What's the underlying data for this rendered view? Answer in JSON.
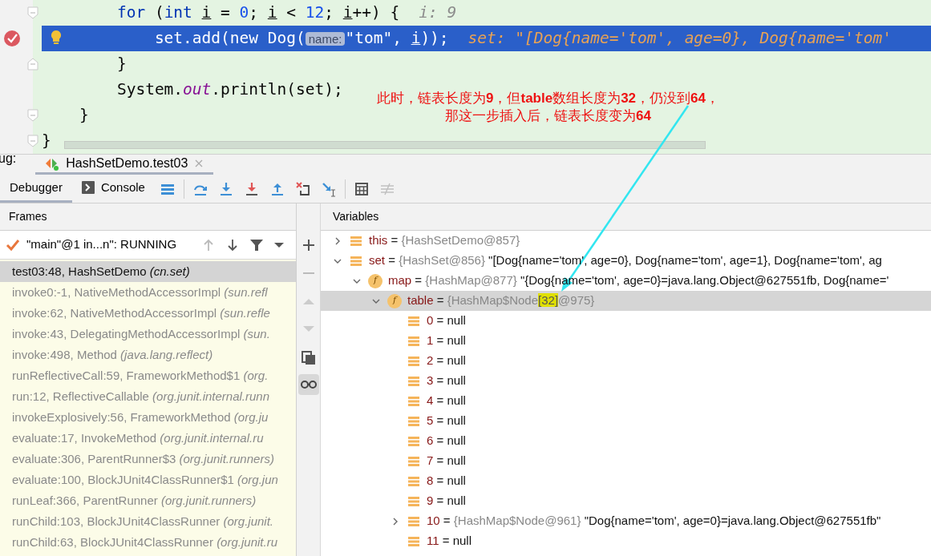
{
  "editor": {
    "lines": [
      {
        "fold": true,
        "breakpoint": false,
        "bulb": false,
        "selected": false,
        "segments": [
          {
            "kind": "keyword",
            "text": "        for"
          },
          {
            "kind": "plain",
            "text": " ("
          },
          {
            "kind": "keyword",
            "text": "int "
          },
          {
            "kind": "var",
            "text": "i"
          },
          {
            "kind": "plain",
            "text": " = "
          },
          {
            "kind": "number",
            "text": "0"
          },
          {
            "kind": "plain",
            "text": "; "
          },
          {
            "kind": "var",
            "text": "i"
          },
          {
            "kind": "plain",
            "text": " < "
          },
          {
            "kind": "number",
            "text": "12"
          },
          {
            "kind": "plain",
            "text": "; "
          },
          {
            "kind": "var",
            "text": "i"
          },
          {
            "kind": "plain",
            "text": "++) {"
          }
        ],
        "inline_value": "i: 9"
      },
      {
        "fold": false,
        "breakpoint": true,
        "bulb": true,
        "selected": true,
        "segments": [
          {
            "kind": "plain",
            "text": "            set.add(new Dog("
          },
          {
            "kind": "hint",
            "text": "name:"
          },
          {
            "kind": "plain",
            "text": "\"tom\", "
          },
          {
            "kind": "var",
            "text": "i"
          },
          {
            "kind": "plain",
            "text": "));"
          }
        ],
        "inline_value": "set: \"[Dog{name='tom', age=0}, Dog{name='tom'"
      },
      {
        "fold": true,
        "breakpoint": false,
        "bulb": false,
        "selected": false,
        "segments": [
          {
            "kind": "plain",
            "text": "        }"
          }
        ]
      },
      {
        "fold": false,
        "breakpoint": false,
        "bulb": false,
        "selected": false,
        "segments": [
          {
            "kind": "plain",
            "text": "        System."
          },
          {
            "kind": "field",
            "text": "out"
          },
          {
            "kind": "plain",
            "text": ".println(set);"
          }
        ]
      },
      {
        "fold": true,
        "breakpoint": false,
        "bulb": false,
        "selected": false,
        "segments": [
          {
            "kind": "plain",
            "text": "    }"
          }
        ]
      },
      {
        "fold": true,
        "breakpoint": false,
        "bulb": false,
        "selected": false,
        "segments": [
          {
            "kind": "plain",
            "text": "}"
          }
        ]
      }
    ]
  },
  "annotation": {
    "lines": [
      "此时，链表长度为**9**，但**table**数组长度为**32**，仍没到**64**，",
      "那这一步插入后，链表长度变为**64**"
    ]
  },
  "debug_bar": {
    "label": "ug:",
    "tabs": [
      {
        "title": "HashSetDemo.test03",
        "selected": true
      }
    ]
  },
  "toolbar": {
    "tabs": [
      {
        "label": "Debugger",
        "selected": true,
        "kind": "debugger"
      },
      {
        "label": "Console",
        "selected": false,
        "kind": "console"
      }
    ]
  },
  "frames": {
    "title": "Frames",
    "thread": "\"main\"@1 in...n\": RUNNING",
    "items": [
      {
        "text": "test03:48, HashSetDemo",
        "package": "(cn.set)",
        "selected": true
      },
      {
        "text": "invoke0:-1, NativeMethodAccessorImpl",
        "package": "(sun.refl",
        "selected": false
      },
      {
        "text": "invoke:62, NativeMethodAccessorImpl",
        "package": "(sun.refle",
        "selected": false
      },
      {
        "text": "invoke:43, DelegatingMethodAccessorImpl",
        "package": "(sun.",
        "selected": false
      },
      {
        "text": "invoke:498, Method",
        "package": "(java.lang.reflect)",
        "selected": false
      },
      {
        "text": "runReflectiveCall:59, FrameworkMethod$1",
        "package": "(org.",
        "selected": false
      },
      {
        "text": "run:12, ReflectiveCallable",
        "package": "(org.junit.internal.runn",
        "selected": false
      },
      {
        "text": "invokeExplosively:56, FrameworkMethod",
        "package": "(org.ju",
        "selected": false
      },
      {
        "text": "evaluate:17, InvokeMethod",
        "package": "(org.junit.internal.ru",
        "selected": false
      },
      {
        "text": "evaluate:306, ParentRunner$3",
        "package": "(org.junit.runners)",
        "selected": false
      },
      {
        "text": "evaluate:100, BlockJUnit4ClassRunner$1",
        "package": "(org.jun",
        "selected": false
      },
      {
        "text": "runLeaf:366, ParentRunner",
        "package": "(org.junit.runners)",
        "selected": false
      },
      {
        "text": "runChild:103, BlockJUnit4ClassRunner",
        "package": "(org.junit.",
        "selected": false
      },
      {
        "text": "runChild:63, BlockJUnit4ClassRunner",
        "package": "(org.junit.ru",
        "selected": false
      }
    ]
  },
  "variables": {
    "title": "Variables",
    "tree": [
      {
        "name": "this",
        "eq": "=",
        "kind": "variable",
        "type": "{HashSetDemo@857}",
        "expanded": false,
        "selected": false
      },
      {
        "name": "set",
        "eq": "=",
        "kind": "variable",
        "type": "{HashSet@856}",
        "value": "\"[Dog{name='tom', age=0}, Dog{name='tom', age=1}, Dog{name='tom', ag",
        "expanded": true,
        "selected": false,
        "children": [
          {
            "name": "map",
            "eq": "=",
            "kind": "field",
            "badge": "f",
            "type": "{HashMap@877}",
            "value": "\"{Dog{name='tom', age=0}=java.lang.Object@627551fb, Dog{name='",
            "expanded": true,
            "selected": false,
            "children": [
              {
                "name": "table",
                "eq": "=",
                "kind": "field",
                "badge": "f",
                "type_parts": [
                  {
                    "text": "{HashMap$Node",
                    "highlighted": false
                  },
                  {
                    "text": "[32]",
                    "highlighted": true
                  },
                  {
                    "text": "@975}",
                    "highlighted": false
                  }
                ],
                "expanded": true,
                "selected": true,
                "children": [
                  {
                    "name": "0",
                    "eq": "=",
                    "kind": "variable",
                    "value": "null",
                    "selected": false
                  },
                  {
                    "name": "1",
                    "eq": "=",
                    "kind": "variable",
                    "value": "null",
                    "selected": false
                  },
                  {
                    "name": "2",
                    "eq": "=",
                    "kind": "variable",
                    "value": "null",
                    "selected": false
                  },
                  {
                    "name": "3",
                    "eq": "=",
                    "kind": "variable",
                    "value": "null",
                    "selected": false
                  },
                  {
                    "name": "4",
                    "eq": "=",
                    "kind": "variable",
                    "value": "null",
                    "selected": false
                  },
                  {
                    "name": "5",
                    "eq": "=",
                    "kind": "variable",
                    "value": "null",
                    "selected": false
                  },
                  {
                    "name": "6",
                    "eq": "=",
                    "kind": "variable",
                    "value": "null",
                    "selected": false
                  },
                  {
                    "name": "7",
                    "eq": "=",
                    "kind": "variable",
                    "value": "null",
                    "selected": false
                  },
                  {
                    "name": "8",
                    "eq": "=",
                    "kind": "variable",
                    "value": "null",
                    "selected": false
                  },
                  {
                    "name": "9",
                    "eq": "=",
                    "kind": "variable",
                    "value": "null",
                    "selected": false
                  },
                  {
                    "name": "10",
                    "eq": "=",
                    "kind": "variable",
                    "type": "{HashMap$Node@961}",
                    "value": "\"Dog{name='tom', age=0}=java.lang.Object@627551fb\"",
                    "expanded": false,
                    "selected": false
                  },
                  {
                    "name": "11",
                    "eq": "=",
                    "kind": "variable",
                    "value": "null",
                    "selected": false
                  }
                ]
              }
            ]
          }
        ]
      }
    ]
  }
}
